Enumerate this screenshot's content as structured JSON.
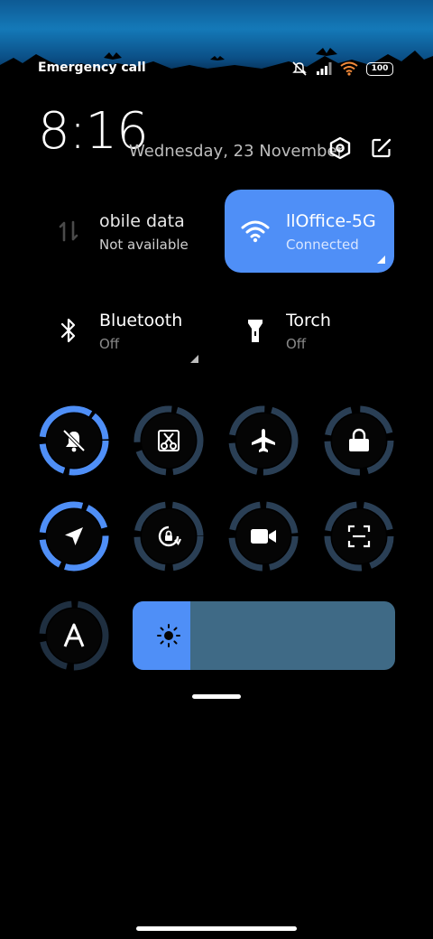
{
  "status_bar": {
    "carrier_text": "Emergency calls o",
    "battery_level": "100"
  },
  "header": {
    "time": "8:16",
    "date": "Wednesday, 23 November"
  },
  "tiles": {
    "mobile_data": {
      "title": "obile data",
      "status": "Not available"
    },
    "wifi": {
      "title": "llOffice-5G",
      "status": "Connected"
    },
    "bluetooth": {
      "title": "Bluetooth",
      "status": "Off"
    },
    "torch": {
      "title": "Torch",
      "status": "Off"
    }
  },
  "toggles": [
    {
      "name": "silent-mode",
      "icon": "bell-off-icon",
      "active": true
    },
    {
      "name": "screenshot",
      "icon": "scissors-icon",
      "active": false
    },
    {
      "name": "airplane-mode",
      "icon": "airplane-icon",
      "active": false
    },
    {
      "name": "lock-screen",
      "icon": "lock-icon",
      "active": false
    },
    {
      "name": "location",
      "icon": "location-arrow-icon",
      "active": true
    },
    {
      "name": "rotation-lock",
      "icon": "rotation-lock-icon",
      "active": false
    },
    {
      "name": "screen-recorder",
      "icon": "video-camera-icon",
      "active": false
    },
    {
      "name": "scanner",
      "icon": "scan-icon",
      "active": false
    },
    {
      "name": "auto-brightness",
      "icon": "letter-a-icon",
      "active": false
    }
  ],
  "brightness": {
    "level": 0.22
  },
  "colors": {
    "accent": "#4f8ff7",
    "slider_track": "#3f6a86",
    "background": "#000000"
  }
}
